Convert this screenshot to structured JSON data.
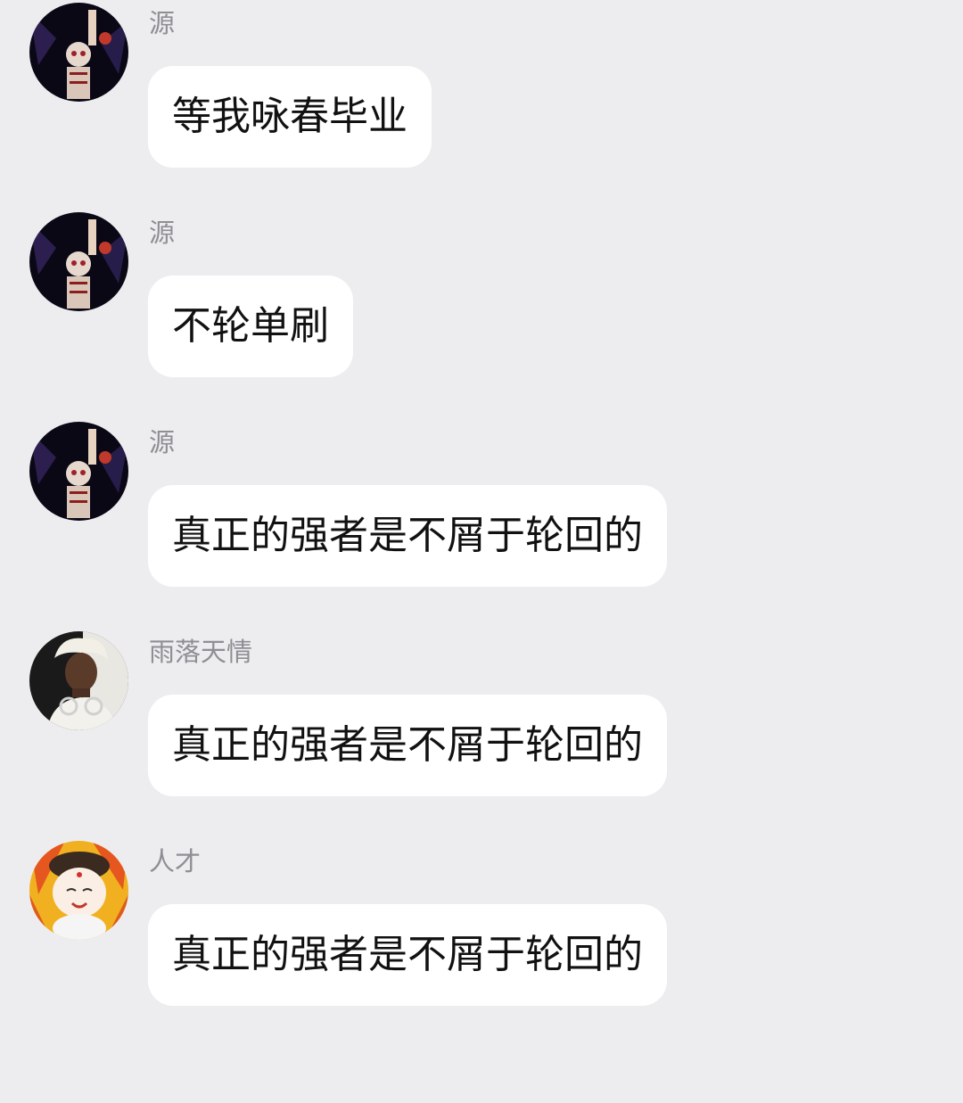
{
  "messages": [
    {
      "sender": "源",
      "avatar": "avatar-dark-artwork",
      "text": "等我咏春毕业"
    },
    {
      "sender": "源",
      "avatar": "avatar-dark-artwork",
      "text": "不轮单刷"
    },
    {
      "sender": "源",
      "avatar": "avatar-dark-artwork",
      "text": "真正的强者是不屑于轮回的"
    },
    {
      "sender": "雨落天情",
      "avatar": "avatar-white-hair-person",
      "text": "真正的强者是不屑于轮回的"
    },
    {
      "sender": "人才",
      "avatar": "avatar-cartoon-child",
      "text": "真正的强者是不屑于轮回的"
    }
  ],
  "colors": {
    "background": "#ededf0",
    "bubble": "#ffffff",
    "sender_name": "#8e8e93",
    "message_text": "#111111"
  }
}
